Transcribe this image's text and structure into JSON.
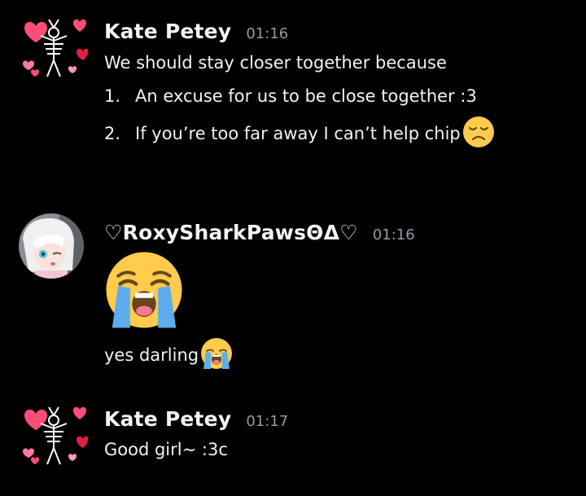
{
  "colors": {
    "background": "#000000",
    "text": "#f2f3f5",
    "timestamp": "#949ba4",
    "emoji_yellow": "#ffcb4c",
    "emoji_tear": "#5dadec"
  },
  "messages": [
    {
      "author": "Kate Petey",
      "time": "01:16",
      "avatar": "heart-skeleton-avatar",
      "intro": "We should stay closer together because",
      "list": [
        {
          "num": "1.",
          "text": "An excuse for us to be close together :3"
        },
        {
          "num": "2.",
          "text": "If you’re too far away I can’t help chip",
          "emoji": "disappointed-face-emoji"
        }
      ]
    },
    {
      "author": "♡RoxySharkPawsΘΔ♡",
      "time": "01:16",
      "avatar": "anime-girl-avatar",
      "big_emoji": "loudly-crying-face-emoji",
      "text": "yes darling",
      "text_emoji": "loudly-crying-face-emoji"
    },
    {
      "author": "Kate Petey",
      "time": "01:17",
      "avatar": "heart-skeleton-avatar",
      "text": "Good girl~ :3c"
    }
  ]
}
